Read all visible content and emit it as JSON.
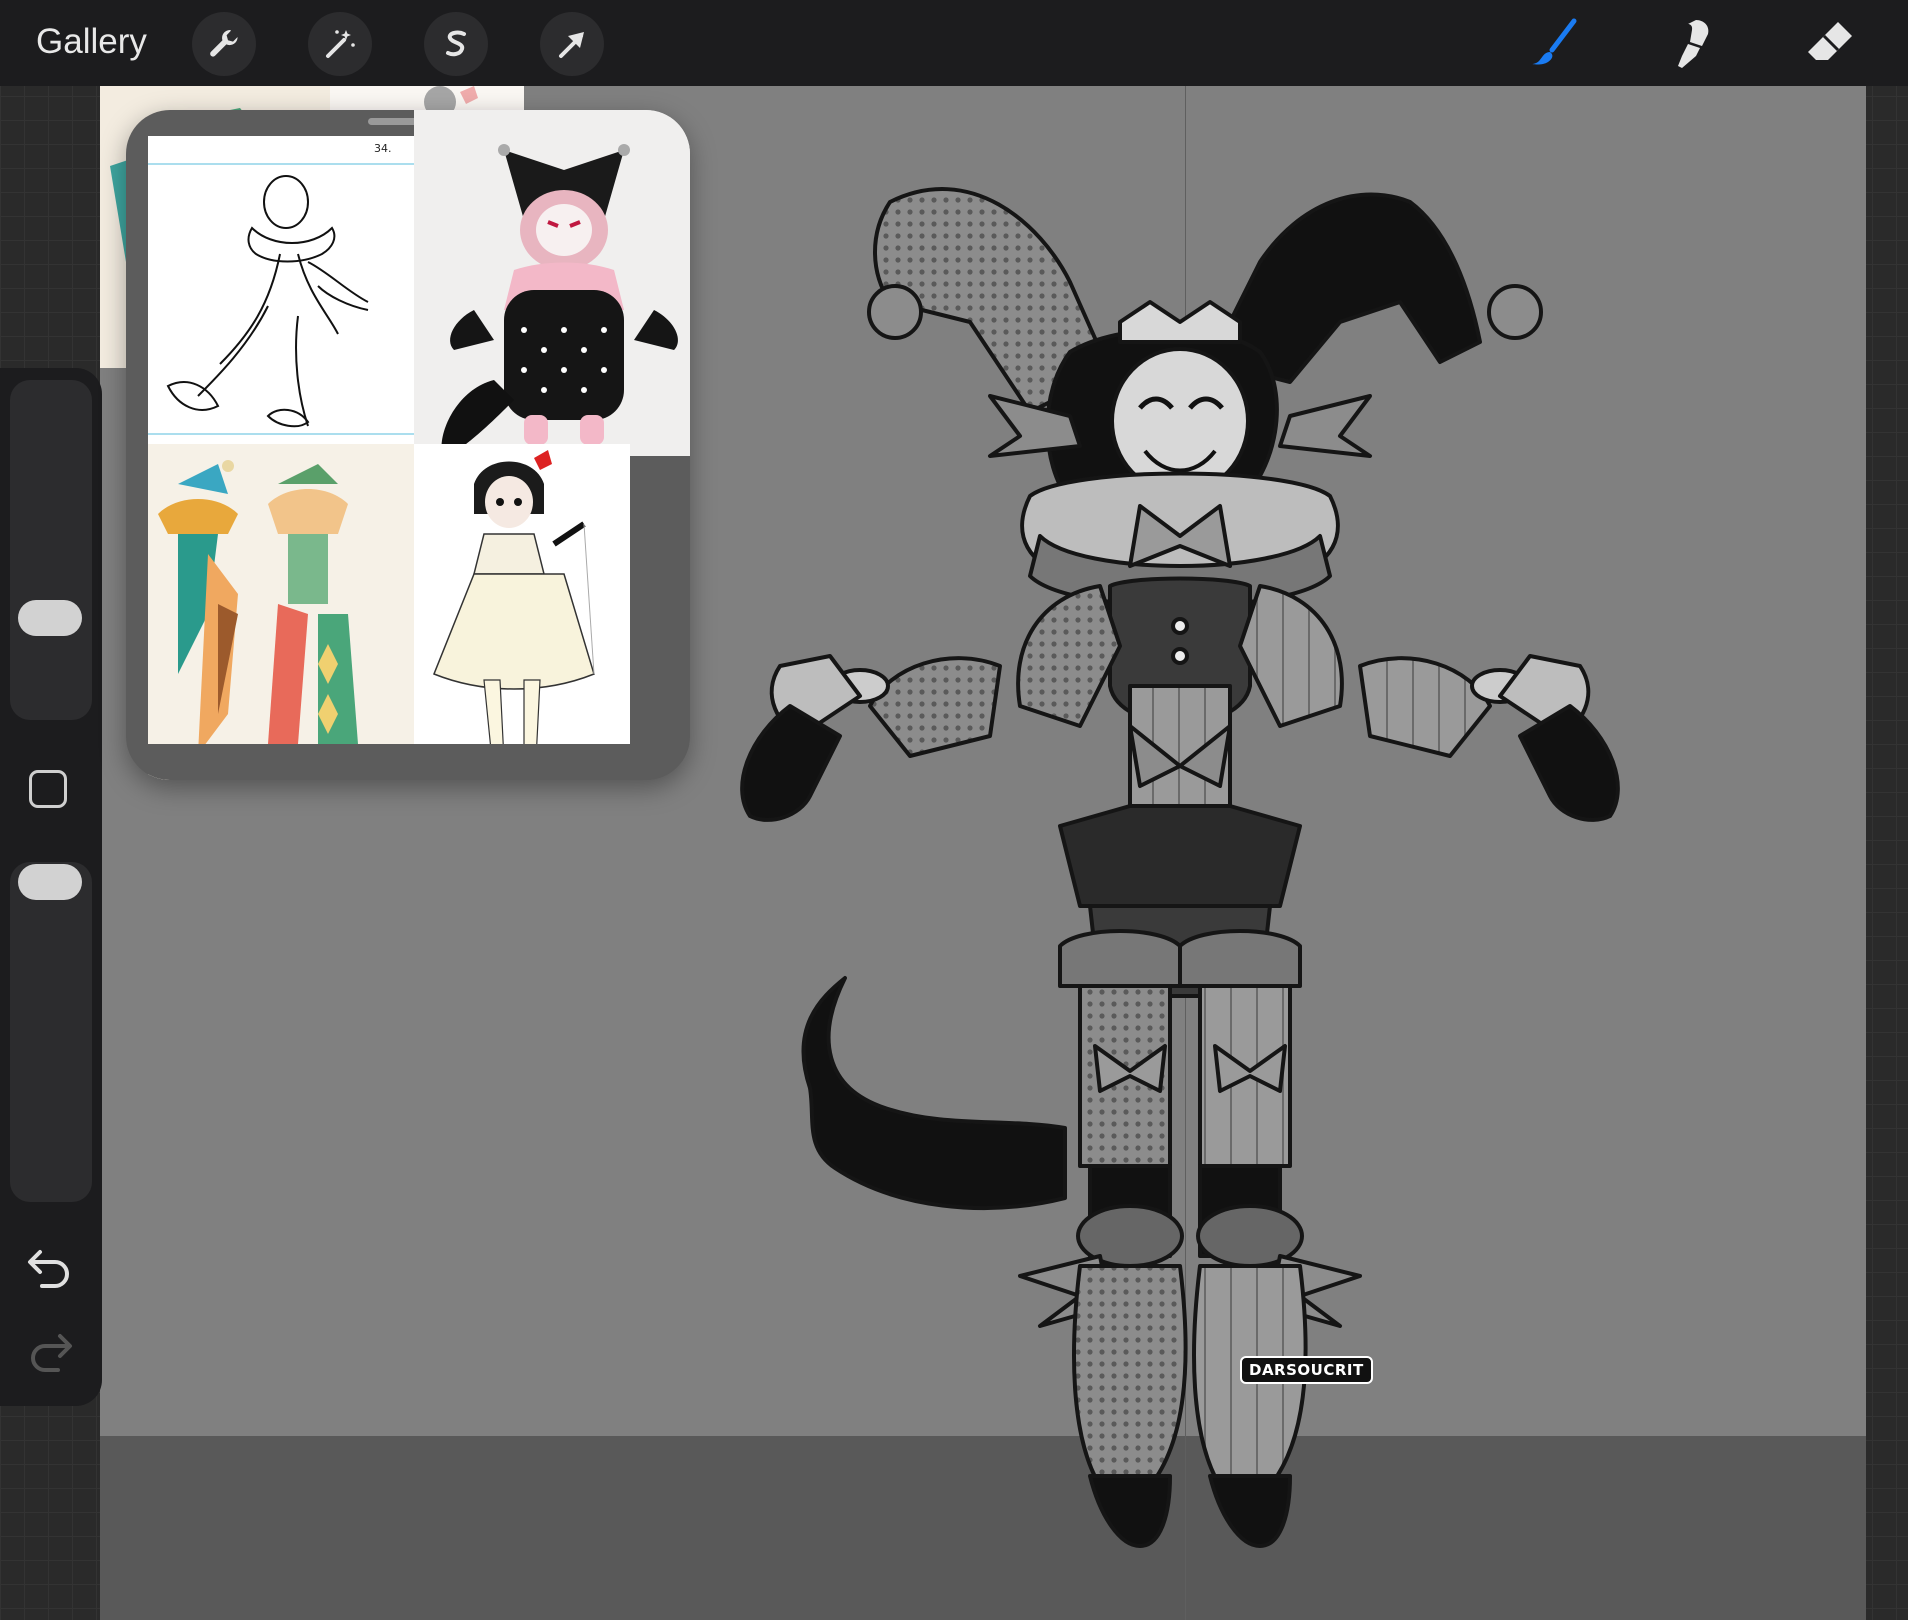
{
  "toolbar": {
    "gallery_label": "Gallery",
    "left_tools": [
      {
        "icon": "wrench-icon",
        "label": "Actions"
      },
      {
        "icon": "magic-wand-icon",
        "label": "Adjustments"
      },
      {
        "icon": "selection-icon",
        "label": "Selection"
      },
      {
        "icon": "transform-arrow-icon",
        "label": "Transform"
      }
    ],
    "right_tools": [
      {
        "icon": "brush-icon",
        "active": true
      },
      {
        "icon": "smudge-icon",
        "active": false
      },
      {
        "icon": "eraser-icon",
        "active": false
      }
    ],
    "active_color": "#1a7bf2"
  },
  "sidebar": {
    "size_slider": {
      "level": 0.35
    },
    "opacity_slider": {
      "level": 0.92
    },
    "modify_icon": "square-modify-icon",
    "undo_icon": "undo-icon",
    "redo_icon": "redo-icon"
  },
  "reference_window": {
    "page_number": "34.",
    "images": [
      "pierrot-line-sketch",
      "jester-plush-doll",
      "harlequin-pair-illustration",
      "girl-white-dress-illustration"
    ]
  },
  "canvas": {
    "watermark": "DARSOUCRIT",
    "background_color": "#808080"
  }
}
